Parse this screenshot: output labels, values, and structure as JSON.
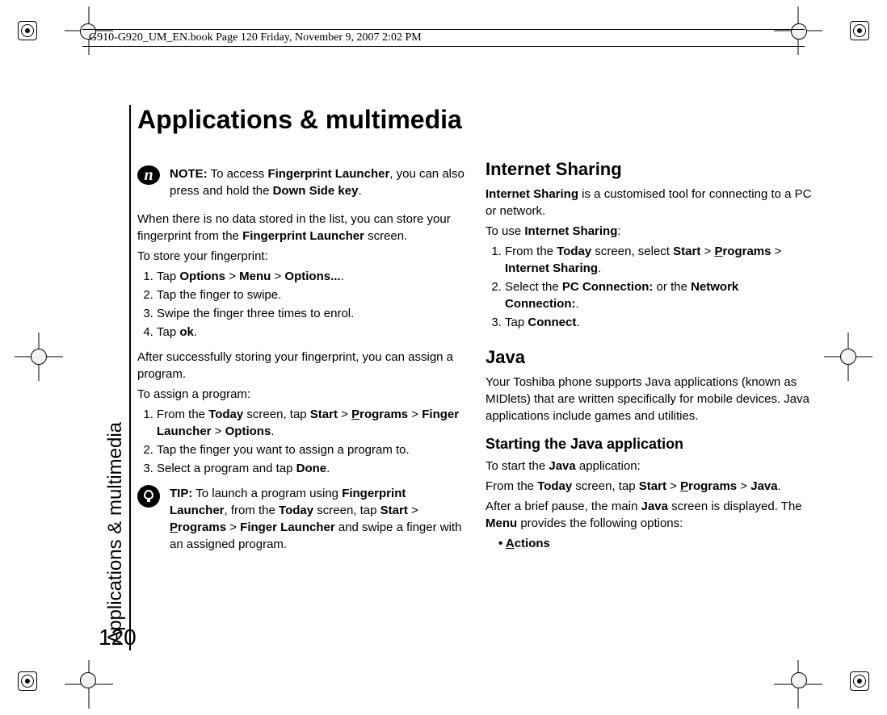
{
  "header": "G910-G920_UM_EN.book  Page 120  Friday, November 9, 2007  2:02 PM",
  "sideLabel": "Applications & multimedia",
  "pageNumber": "120",
  "title": "Applications & multimedia",
  "note1_pre": "NOTE:",
  "note1_t1": " To access ",
  "note1_b1": "Fingerprint Launcher",
  "note1_t2": ", you can also press and hold the ",
  "note1_b2": "Down Side key",
  "note1_t3": ".",
  "p1_t1": "When there is no data stored in the list, you can store your fingerprint from the ",
  "p1_b1": "Fingerprint Launcher",
  "p1_t2": " screen.",
  "p2": "To store your fingerprint:",
  "s1_1_t1": "Tap ",
  "s1_1_b1": "Options",
  "s1_1_t2": " > ",
  "s1_1_b2": "Menu",
  "s1_1_t3": " > ",
  "s1_1_b3": "Options...",
  "s1_1_t4": ".",
  "s1_2": "Tap the finger to swipe.",
  "s1_3": "Swipe the finger three times to enrol.",
  "s1_4_t1": "Tap ",
  "s1_4_b1": "ok",
  "s1_4_t2": ".",
  "p3": "After successfully storing your fingerprint, you can assign a program.",
  "p4": "To assign a program:",
  "s2_1_t1": "From the ",
  "s2_1_b1": "Today",
  "s2_1_t2": " screen, tap ",
  "s2_1_b2": "Start",
  "s2_1_t3": " > ",
  "s2_1_u1": "P",
  "s2_1_b3": "rograms",
  "s2_1_t4": " > ",
  "s2_1_b4": "Finger Launcher",
  "s2_1_t5": " > ",
  "s2_1_b5": "Options",
  "s2_1_t6": ".",
  "s2_2": "Tap the finger you want to assign a program to.",
  "s2_3_t1": "Select a program and tap ",
  "s2_3_b1": "Done",
  "s2_3_t2": ".",
  "tip_pre": "TIP:",
  "tip_t1": " To launch a program using ",
  "tip_b1": "Fingerprint Launcher",
  "tip_t2": ", from the ",
  "tip_b2": "Today",
  "tip_t3": " screen, tap ",
  "tip_b3": "Start",
  "tip_t4": " > ",
  "tip_u1": "P",
  "tip_b4": "rograms",
  "tip_t5": " > ",
  "tip_b5": "Finger Launcher",
  "tip_t6": " and swipe a finger with an assigned program.",
  "h2_1": "Internet Sharing",
  "is_p1_b1": "Internet Sharing",
  "is_p1_t1": " is a customised tool for connecting to a PC or network.",
  "is_p2_t1": "To use ",
  "is_p2_b1": "Internet Sharing",
  "is_p2_t2": ":",
  "is_s1_t1": "From the ",
  "is_s1_b1": "Today",
  "is_s1_t2": " screen, select ",
  "is_s1_b2": "Start",
  "is_s1_t3": " > ",
  "is_s1_u1": "P",
  "is_s1_b3": "rograms",
  "is_s1_t4": " > ",
  "is_s1_b4": "Internet Sharing",
  "is_s1_t5": ".",
  "is_s2_t1": "Select the ",
  "is_s2_b1": "PC Connection:",
  "is_s2_t2": " or the ",
  "is_s2_b2": "Network Connection:",
  "is_s2_t3": ".",
  "is_s3_t1": "Tap ",
  "is_s3_b1": "Connect",
  "is_s3_t2": ".",
  "h2_2": "Java",
  "jv_p1": "Your Toshiba phone supports Java applications (known as MIDlets) that are written specifically for mobile devices. Java applications include games and utilities.",
  "h3_1": "Starting the Java application",
  "jv_p2_t1": "To start the ",
  "jv_p2_b1": "Java",
  "jv_p2_t2": " application:",
  "jv_p3_t1": "From the ",
  "jv_p3_b1": "Today",
  "jv_p3_t2": " screen, tap ",
  "jv_p3_b2": "Start",
  "jv_p3_t3": " > ",
  "jv_p3_u1": "P",
  "jv_p3_b3": "rograms",
  "jv_p3_t4": " > ",
  "jv_p3_b4": "Java",
  "jv_p3_t5": ".",
  "jv_p4_t1": "After a brief pause, the main ",
  "jv_p4_b1": "Java",
  "jv_p4_t2": " screen is displayed. The ",
  "jv_p4_b2": "Menu",
  "jv_p4_t3": " provides the following options:",
  "jv_li1_u1": "A",
  "jv_li1_b1": "ctions"
}
